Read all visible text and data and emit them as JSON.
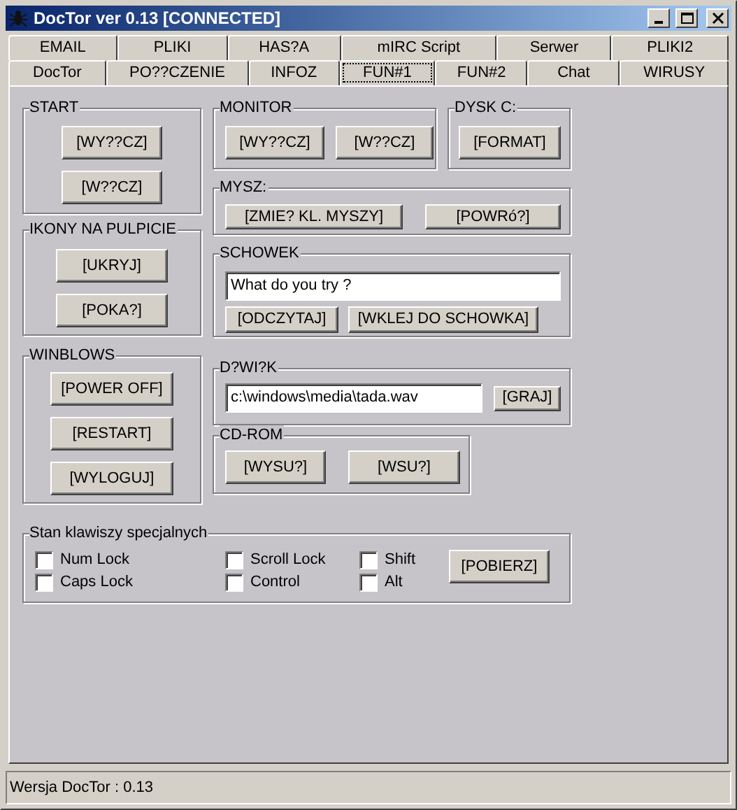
{
  "window": {
    "title": "DocTor ver 0.13 [CONNECTED]"
  },
  "tabs": [
    [
      {
        "label": "EMAIL",
        "selected": false
      },
      {
        "label": "PLIKI",
        "selected": false
      },
      {
        "label": "HAS?A",
        "selected": false
      },
      {
        "label": "mIRC Script",
        "selected": false
      },
      {
        "label": "Serwer",
        "selected": false
      },
      {
        "label": "PLIKI2",
        "selected": false
      }
    ],
    [
      {
        "label": "DocTor",
        "selected": false
      },
      {
        "label": "PO??CZENIE",
        "selected": false
      },
      {
        "label": "INFOZ",
        "selected": false
      },
      {
        "label": "FUN#1",
        "selected": true
      },
      {
        "label": "FUN#2",
        "selected": false
      },
      {
        "label": "Chat",
        "selected": false
      },
      {
        "label": "WIRUSY",
        "selected": false
      }
    ]
  ],
  "groups": [
    {
      "title": "START",
      "items": [
        {
          "kind": "button",
          "label": "[WY??CZ]"
        },
        {
          "kind": "button",
          "label": "[W??CZ]"
        }
      ]
    },
    {
      "title": "IKONY NA PULPICIE",
      "items": [
        {
          "kind": "button",
          "label": "[UKRYJ]"
        },
        {
          "kind": "button",
          "label": "[POKA?]"
        }
      ]
    },
    {
      "title": "WINBLOWS",
      "items": [
        {
          "kind": "button",
          "label": "[POWER OFF]"
        },
        {
          "kind": "button",
          "label": "[RESTART]"
        },
        {
          "kind": "button",
          "label": "[WYLOGUJ]"
        }
      ]
    },
    {
      "title": "MONITOR",
      "items": [
        {
          "kind": "button",
          "label": "[WY??CZ]"
        },
        {
          "kind": "button",
          "label": "[W??CZ]"
        }
      ]
    },
    {
      "title": "DYSK C:",
      "items": [
        {
          "kind": "button",
          "label": "[FORMAT]"
        }
      ]
    },
    {
      "title": "MYSZ:",
      "items": [
        {
          "kind": "button",
          "label": "[ZMIE? KL. MYSZY]"
        },
        {
          "kind": "button",
          "label": "[POWRó?]"
        }
      ]
    },
    {
      "title": "SCHOWEK",
      "items": [
        {
          "kind": "input",
          "value": "What do you try ?"
        },
        {
          "kind": "button",
          "label": "[ODCZYTAJ]"
        },
        {
          "kind": "button",
          "label": "[WKLEJ DO SCHOWKA]"
        }
      ]
    },
    {
      "title": "D?WI?K",
      "items": [
        {
          "kind": "input",
          "value": "c:\\windows\\media\\tada.wav"
        },
        {
          "kind": "button",
          "label": "[GRAJ]"
        }
      ]
    },
    {
      "title": "CD-ROM",
      "items": [
        {
          "kind": "button",
          "label": "[WYSU?]"
        },
        {
          "kind": "button",
          "label": "[WSU?]"
        }
      ]
    },
    {
      "title": "Stan klawiszy specjalnych",
      "items": [
        {
          "kind": "checkbox",
          "label": "Num Lock",
          "checked": false
        },
        {
          "kind": "checkbox",
          "label": "Caps Lock",
          "checked": false
        },
        {
          "kind": "checkbox",
          "label": "Scroll Lock",
          "checked": false
        },
        {
          "kind": "checkbox",
          "label": "Control",
          "checked": false
        },
        {
          "kind": "checkbox",
          "label": "Shift",
          "checked": false
        },
        {
          "kind": "checkbox",
          "label": "Alt",
          "checked": false
        },
        {
          "kind": "button",
          "label": "[POBIERZ]"
        }
      ]
    }
  ],
  "status_bar": "Wersja DocTor : 0.13"
}
